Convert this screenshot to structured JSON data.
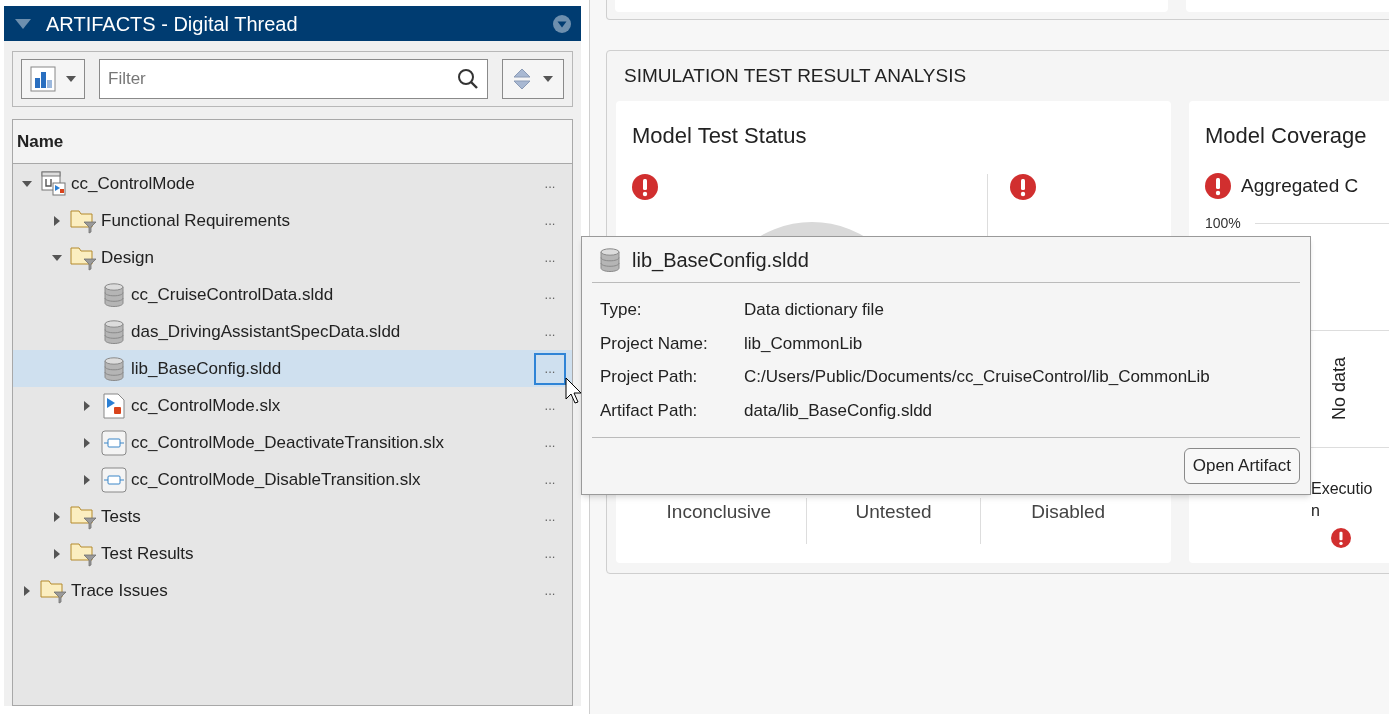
{
  "panel": {
    "title": "ARTIFACTS - Digital Thread",
    "filter": {
      "placeholder": "Filter"
    },
    "column": "Name"
  },
  "tree": [
    {
      "kind": "model",
      "label": "cc_ControlMode",
      "menu": "...",
      "selected": false,
      "expanded": true,
      "children": [
        {
          "kind": "folder",
          "label": "Functional Requirements",
          "menu": "...",
          "selected": false,
          "expanded": false
        },
        {
          "kind": "folder",
          "label": "Design",
          "menu": "...",
          "selected": false,
          "expanded": true,
          "children": [
            {
              "kind": "dictionary",
              "label": "cc_CruiseControlData.sldd",
              "menu": "...",
              "selected": false
            },
            {
              "kind": "dictionary",
              "label": "das_DrivingAssistantSpecData.sldd",
              "menu": "...",
              "selected": false
            },
            {
              "kind": "dictionary",
              "label": "lib_BaseConfig.sldd",
              "menu": "...",
              "selected": true
            },
            {
              "kind": "slx",
              "label": "cc_ControlMode.slx",
              "menu": "...",
              "selected": false,
              "expanded": false
            },
            {
              "kind": "subsystem",
              "label": "cc_ControlMode_DeactivateTransition.slx",
              "menu": "...",
              "selected": false,
              "expanded": false
            },
            {
              "kind": "subsystem",
              "label": "cc_ControlMode_DisableTransition.slx",
              "menu": "...",
              "selected": false,
              "expanded": false
            }
          ]
        },
        {
          "kind": "folder",
          "label": "Tests",
          "menu": "...",
          "selected": false,
          "expanded": false
        },
        {
          "kind": "folder",
          "label": "Test Results",
          "menu": "...",
          "selected": false,
          "expanded": false
        }
      ]
    },
    {
      "kind": "folder",
      "label": "Trace Issues",
      "menu": "...",
      "selected": false,
      "expanded": false
    }
  ],
  "section": {
    "title": "SIMULATION TEST RESULT ANALYSIS",
    "test_status": {
      "title": "Model Test Status",
      "labels": [
        "Inconclusive",
        "Untested",
        "Disabled"
      ]
    },
    "coverage": {
      "title": "Model Coverage",
      "legend": "Aggregated C",
      "tick": "100%",
      "empty": "No data",
      "footer": "Executio\nn"
    }
  },
  "popover": {
    "title": "lib_BaseConfig.sldd",
    "fields": [
      {
        "label": "Type:",
        "value": "Data dictionary file"
      },
      {
        "label": "Project Name:",
        "value": "lib_CommonLib"
      },
      {
        "label": "Project Path:",
        "value": "C:/Users/Public/Documents/cc_CruiseControl/lib_CommonLib"
      },
      {
        "label": "Artifact Path:",
        "value": "data/lib_BaseConfig.sldd"
      }
    ],
    "button": "Open Artifact"
  }
}
